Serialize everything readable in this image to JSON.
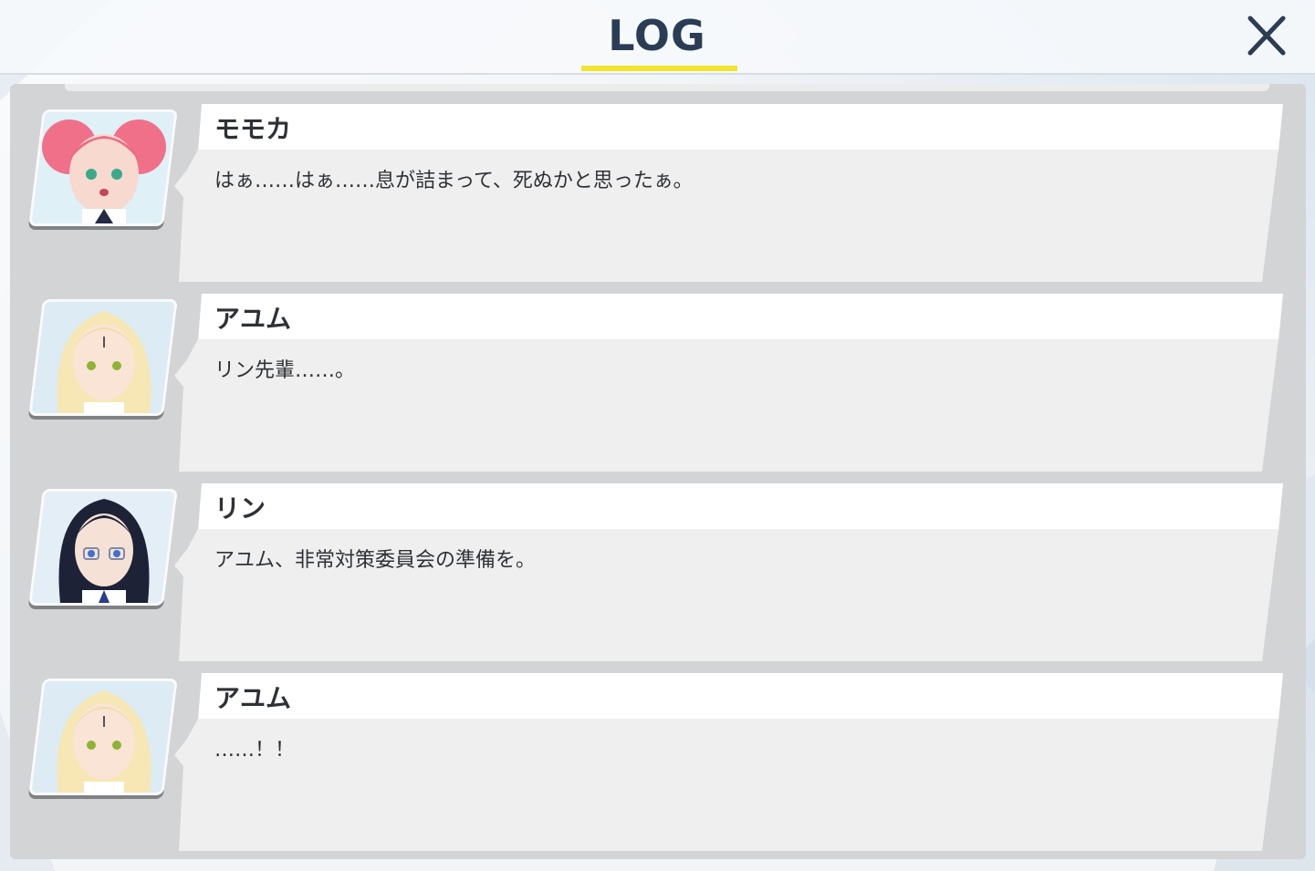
{
  "header": {
    "title": "LOG",
    "accent_color": "#f2e32b",
    "close_icon": "close-icon"
  },
  "log": [
    {
      "speaker": "モモカ",
      "text": "はぁ……はぁ……息が詰まって、死ぬかと思ったぁ。",
      "portrait": "momoka-portrait",
      "hair_color": "#f0708a"
    },
    {
      "speaker": "アユム",
      "text": "リン先輩……。",
      "portrait": "ayumu-portrait",
      "hair_color": "#f6e7b4"
    },
    {
      "speaker": "リン",
      "text": "アユム、非常対策委員会の準備を。",
      "portrait": "rin-portrait",
      "hair_color": "#1d2236"
    },
    {
      "speaker": "アユム",
      "text": "……！！",
      "portrait": "ayumu-portrait",
      "hair_color": "#f6e7b4"
    }
  ]
}
